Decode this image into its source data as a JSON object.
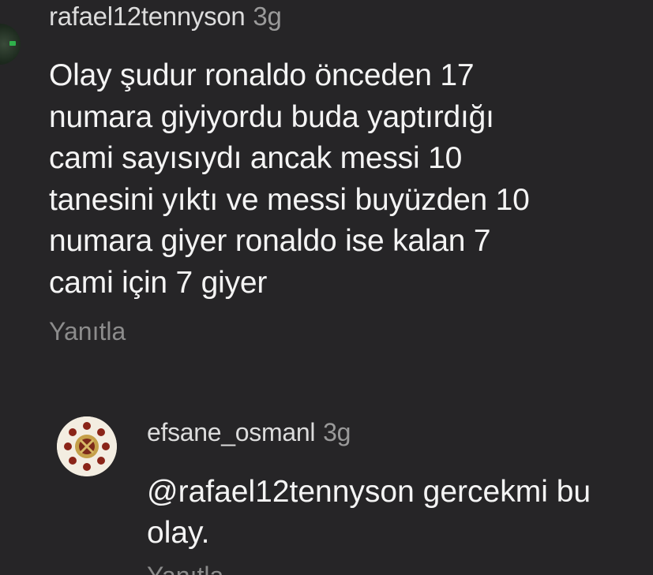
{
  "comment": {
    "username": "rafael12tennyson",
    "time": "3g",
    "body": "Olay şudur ronaldo önceden 17\nnumara giyiyordu buda yaptırdığı\ncami sayısıydı ancak messi 10\ntanesini yıktı ve messi buyüzden 10\nnumara giyer ronaldo ise kalan 7\ncami için 7 giyer",
    "reply_label": "Yanıtla"
  },
  "reply": {
    "username": "efsane_osmanl",
    "time": "3g",
    "body": "@rafael12tennyson gercekmi bu\nolay.",
    "reply_label": "Yanıtla"
  },
  "colors": {
    "background": "#262527",
    "text": "#f4f4f4",
    "muted": "#8c8c8c"
  }
}
